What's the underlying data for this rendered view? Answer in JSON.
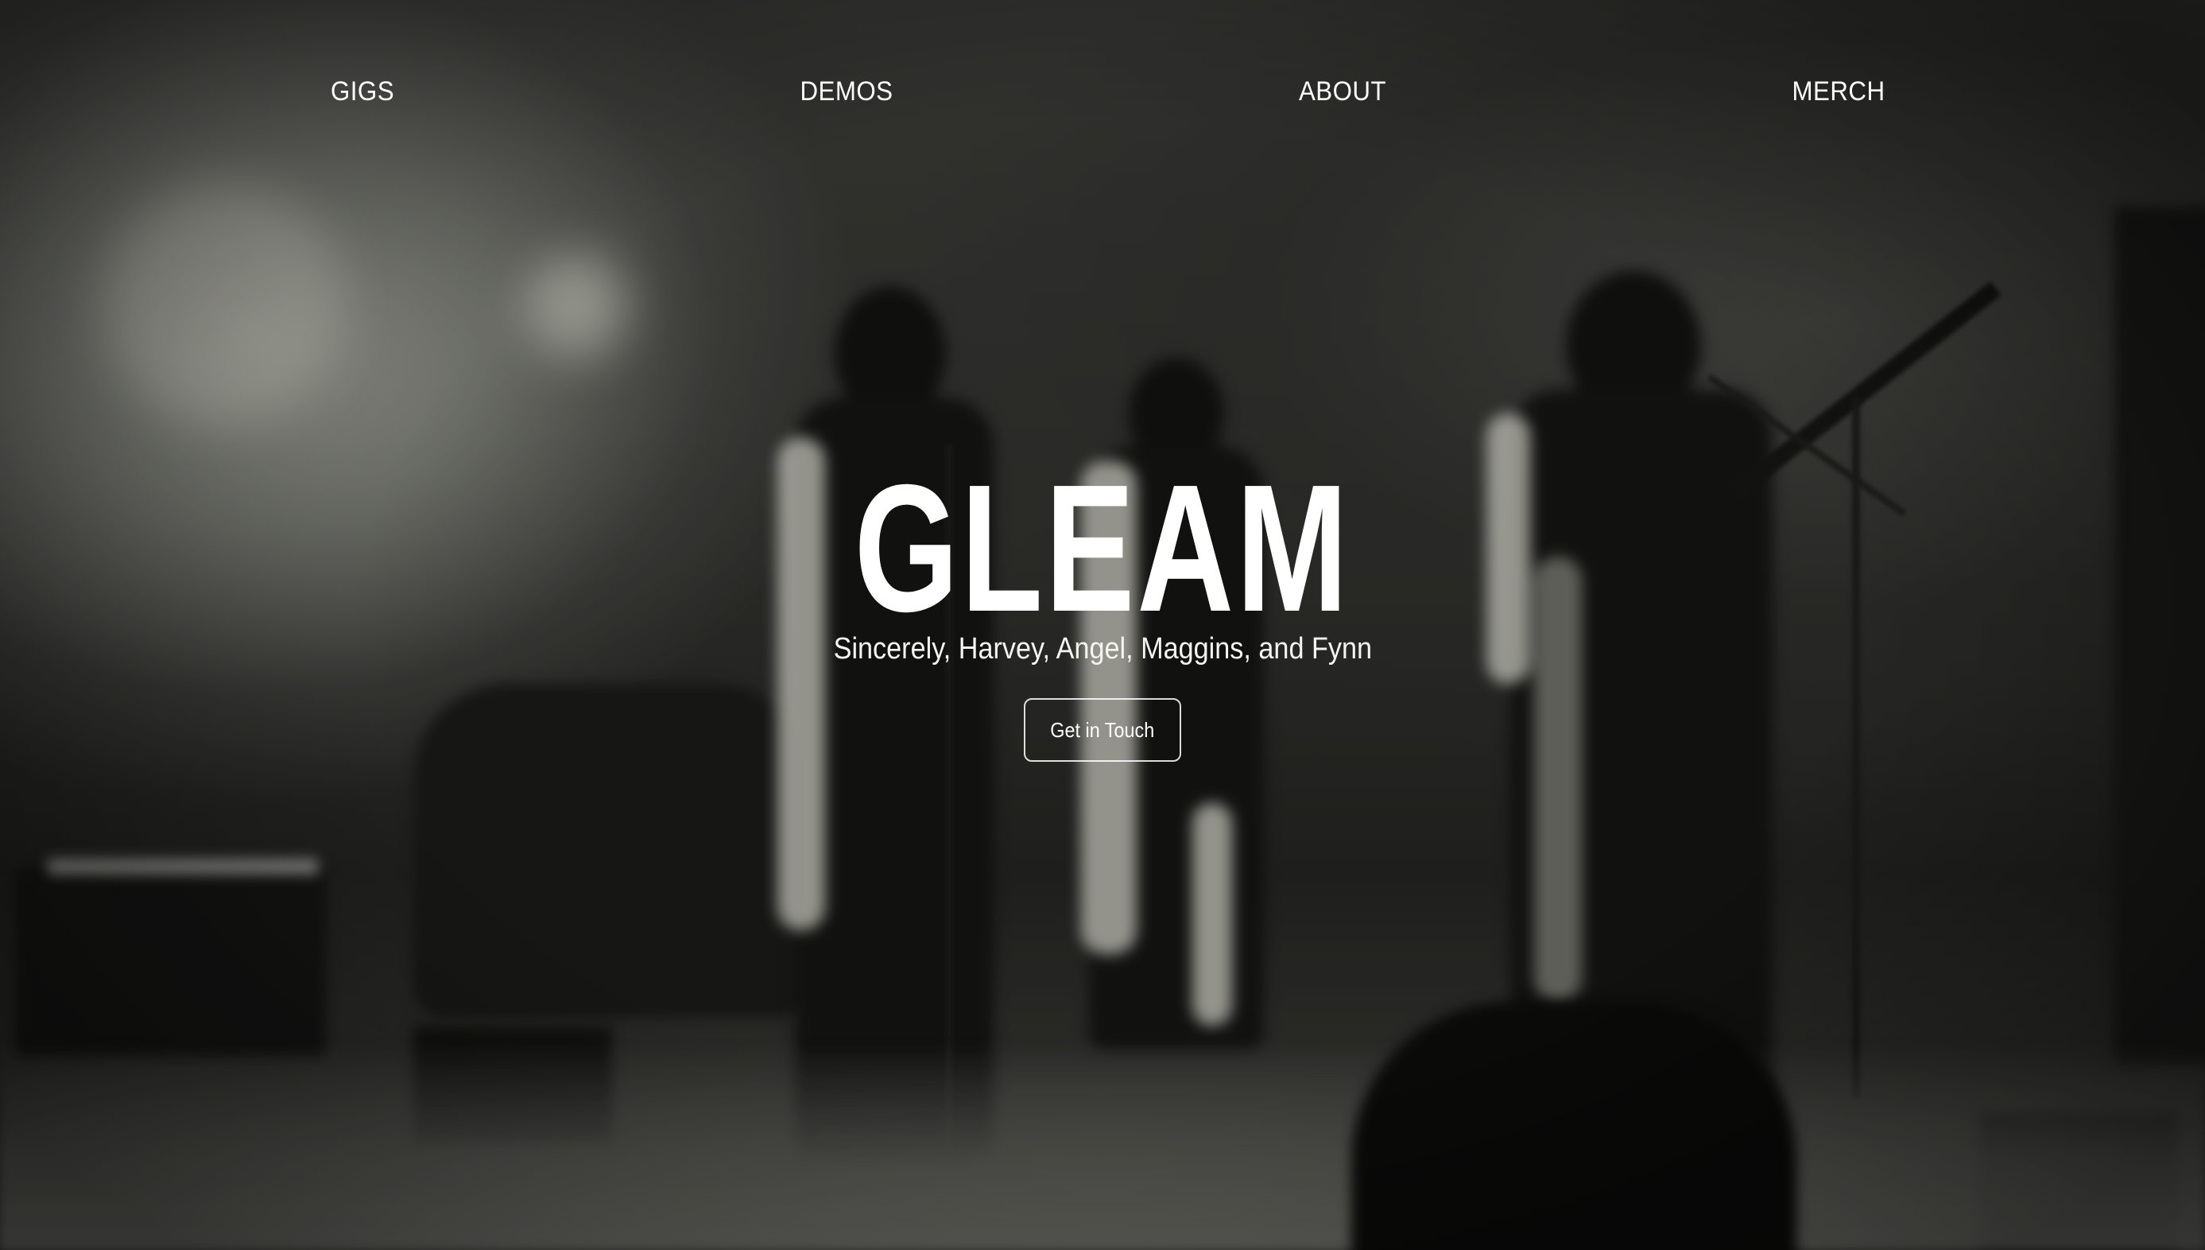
{
  "nav": {
    "items": [
      {
        "label": "GIGS"
      },
      {
        "label": "DEMOS"
      },
      {
        "label": "ABOUT"
      },
      {
        "label": "MERCH"
      }
    ]
  },
  "hero": {
    "title": "GLEAM",
    "subtitle": "Sincerely, Harvey, Angel, Maggins, and Fynn",
    "cta_label": "Get in Touch"
  },
  "background": {
    "description_kind": "photo",
    "tone": "black-and-white",
    "accent": "#ffffff"
  }
}
